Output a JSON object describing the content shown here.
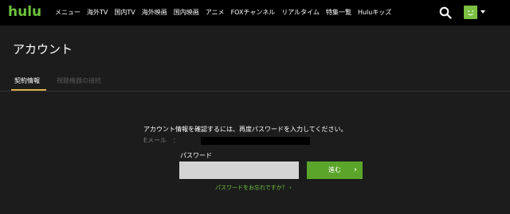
{
  "header": {
    "logo": "hulu",
    "nav": [
      "メニュー",
      "海外TV",
      "国内TV",
      "海外映画",
      "国内映画",
      "アニメ",
      "FOXチャンネル",
      "リアルタイム",
      "特集一覧",
      "Huluキッズ"
    ],
    "search_icon": "search-icon",
    "avatar_color": "#7cc043"
  },
  "page": {
    "title": "アカウント",
    "tabs": [
      {
        "label": "契約情報",
        "active": true
      },
      {
        "label": "視聴機器の接続",
        "active": false
      }
    ]
  },
  "form": {
    "instruction": "アカウント情報を確認するには、再度パスワードを入力してください。",
    "email_label": "Eメール　：",
    "password_label": "パスワード",
    "password_placeholder": "",
    "submit_label": "進む",
    "submit_chevron": "›",
    "forgot_link": "パスワードをお忘れですか？ ›"
  },
  "colors": {
    "brand_green": "#6dc33c",
    "button_green": "#5aa52a",
    "tab_underline": "#d9b04a",
    "background": "#1c1c1c"
  }
}
